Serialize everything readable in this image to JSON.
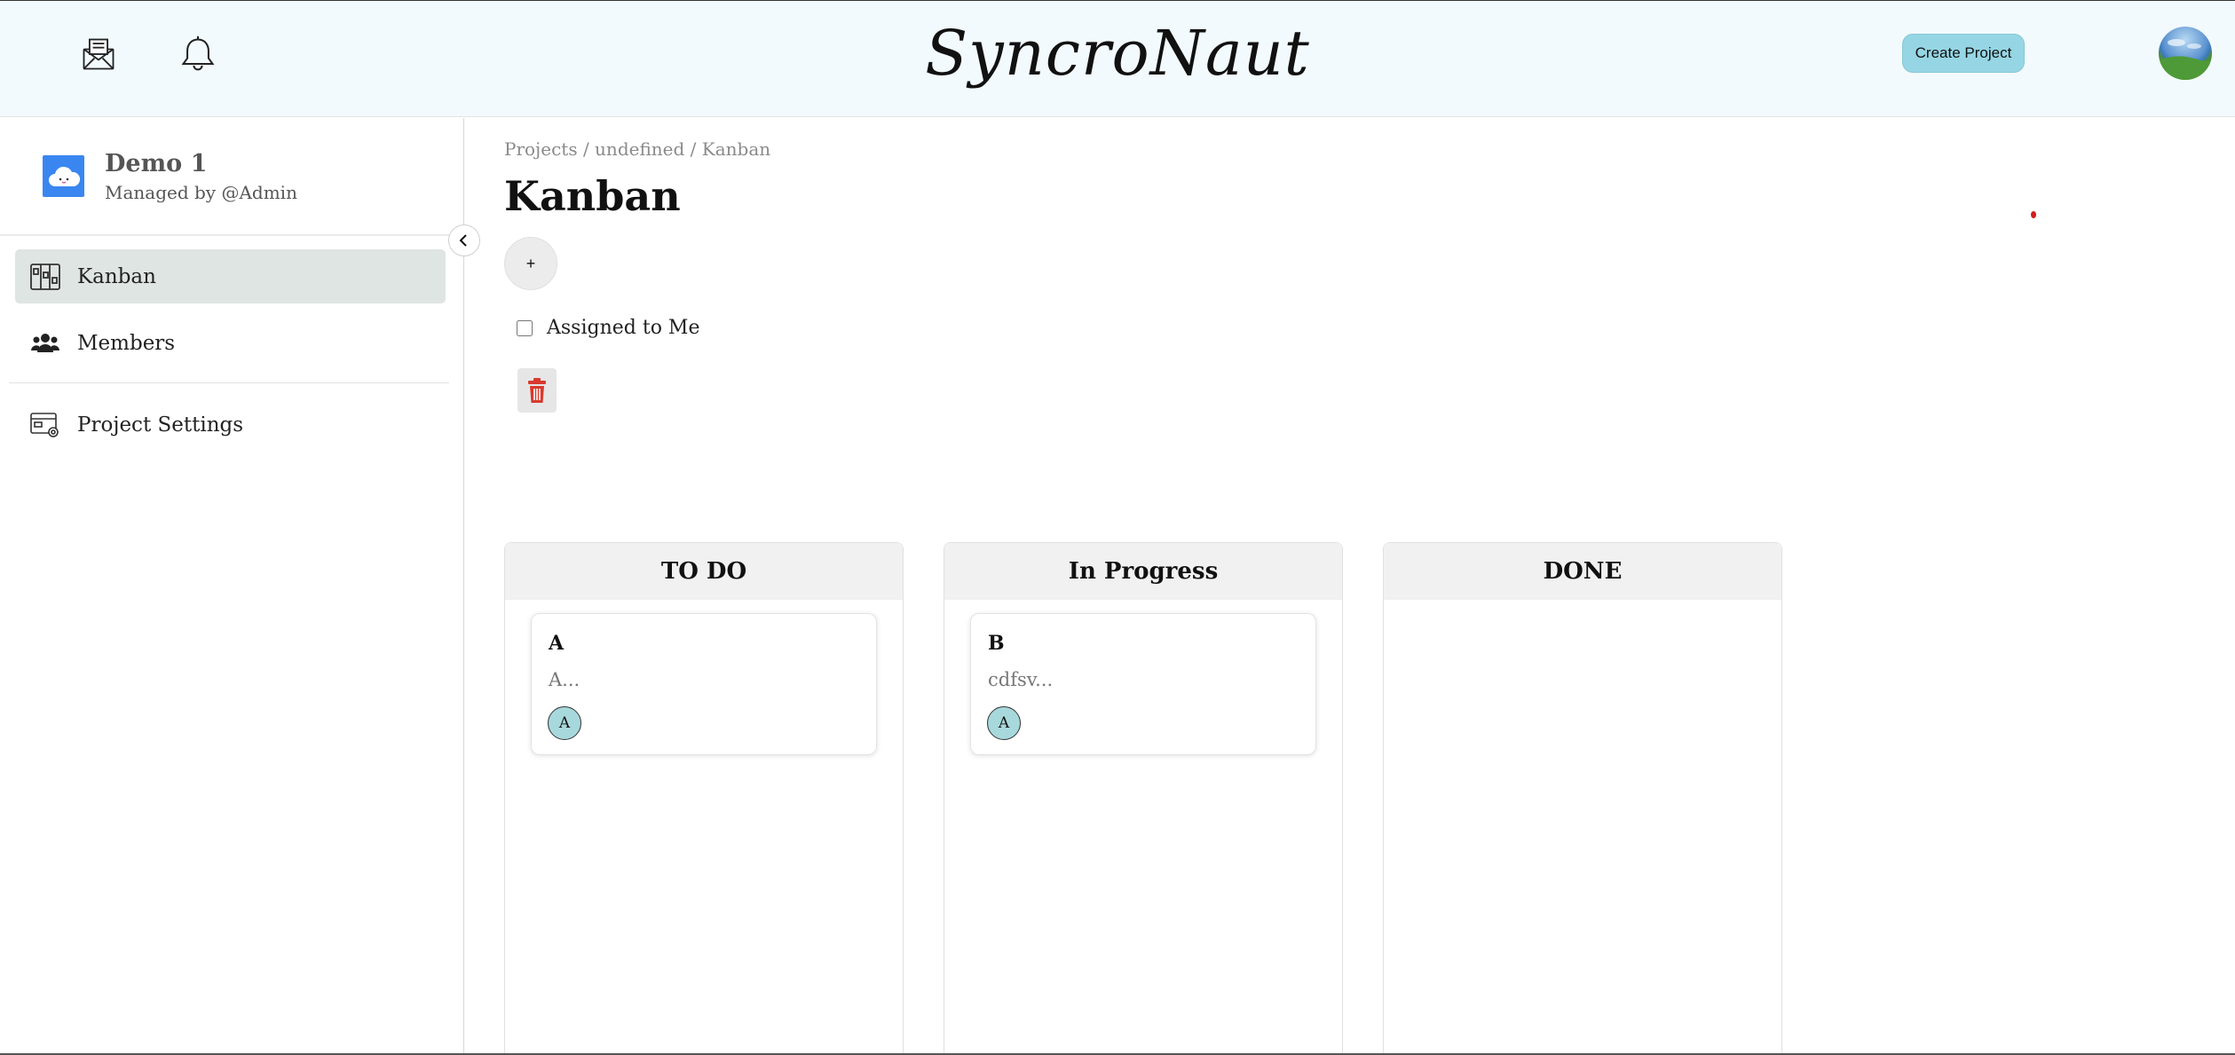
{
  "header": {
    "logo_text": "SyncroNaut",
    "create_project_label": "Create Project",
    "icons": [
      "mail-icon",
      "bell-icon"
    ]
  },
  "sidebar": {
    "project_name": "Demo 1",
    "managed_by": "Managed by @Admin",
    "items": [
      {
        "label": "Kanban",
        "icon": "kanban-board-icon",
        "active": true
      },
      {
        "label": "Members",
        "icon": "users-icon",
        "active": false
      },
      {
        "label": "Project Settings",
        "icon": "settings-window-icon",
        "active": false
      }
    ]
  },
  "main": {
    "breadcrumb": "Projects / undefined / Kanban",
    "title": "Kanban",
    "add_label": "+",
    "assigned_filter_label": "Assigned to Me",
    "assigned_filter_checked": false
  },
  "board": {
    "columns": [
      {
        "title": "TO DO",
        "cards": [
          {
            "title": "A",
            "description": "A...",
            "assignee": "A"
          }
        ]
      },
      {
        "title": "In Progress",
        "cards": [
          {
            "title": "B",
            "description": "cdfsv...",
            "assignee": "A"
          }
        ]
      },
      {
        "title": "DONE",
        "cards": []
      }
    ]
  },
  "colors": {
    "header_bg": "#f2fafd",
    "create_button": "#96d6e4",
    "project_logo": "#3a86f0",
    "trash_icon": "#d83a2e",
    "assignee_badge": "#a7d8dc",
    "active_nav": "#dfe5e3"
  }
}
